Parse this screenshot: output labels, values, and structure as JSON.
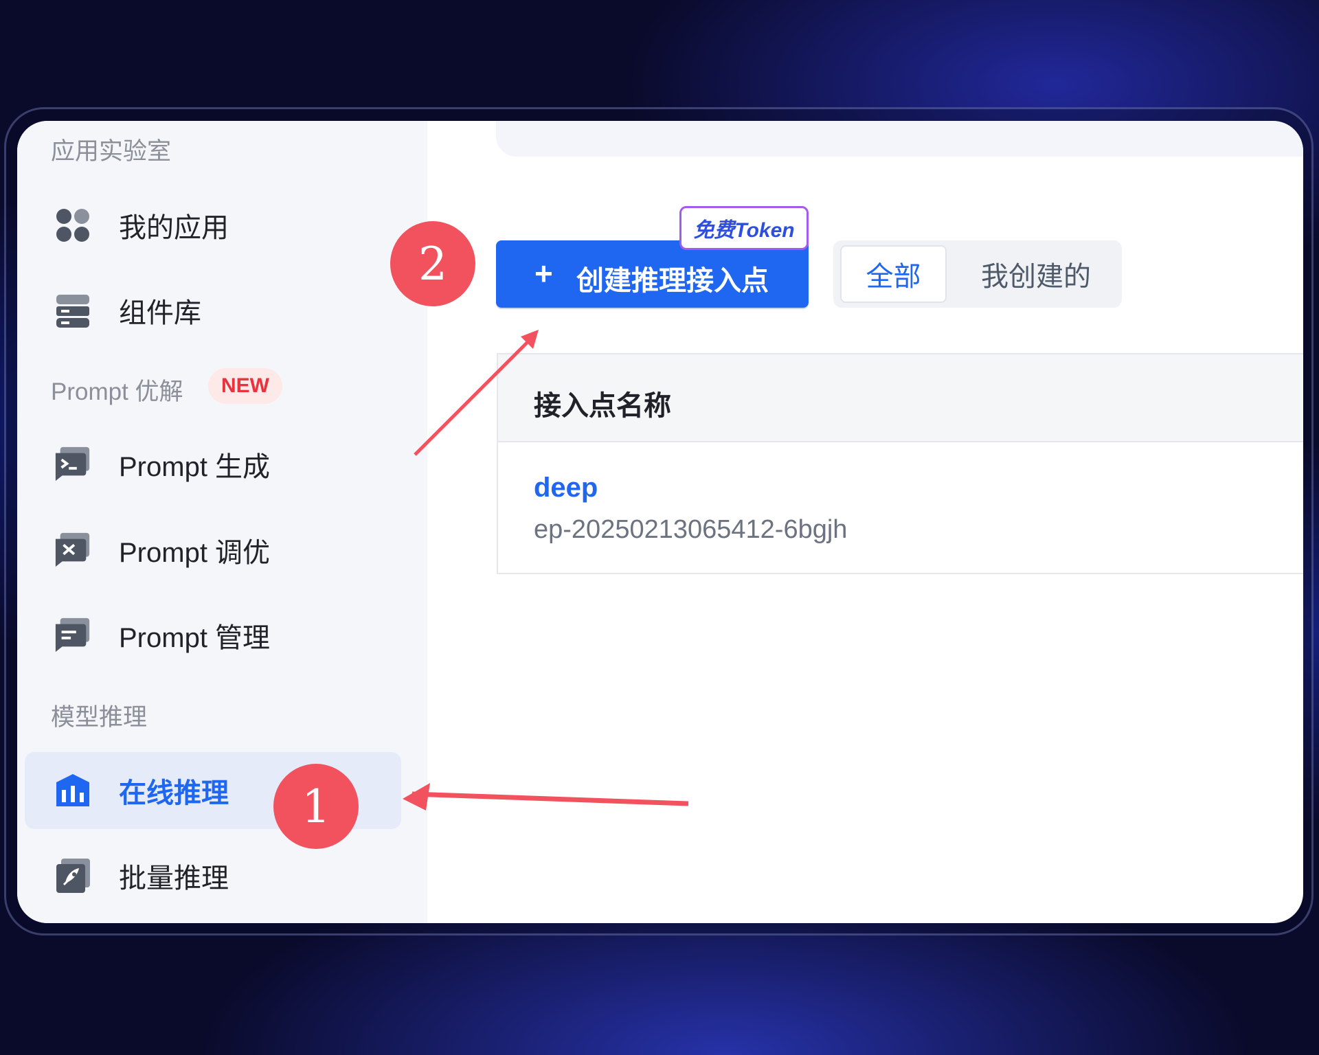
{
  "sidebar": {
    "section_app_lab": "应用实验室",
    "section_prompt": "Prompt 优解",
    "section_prompt_badge": "NEW",
    "section_model_inference": "模型推理",
    "items": [
      {
        "label": "我的应用",
        "icon": "apps-grid-icon"
      },
      {
        "label": "组件库",
        "icon": "component-library-icon"
      },
      {
        "label": "Prompt 生成",
        "icon": "terminal-icon"
      },
      {
        "label": "Prompt 调优",
        "icon": "tune-icon"
      },
      {
        "label": "Prompt 管理",
        "icon": "manage-message-icon"
      },
      {
        "label": "在线推理",
        "icon": "online-inference-icon",
        "active": true
      },
      {
        "label": "批量推理",
        "icon": "rocket-icon"
      }
    ]
  },
  "main": {
    "create_button": {
      "plus": "+",
      "label": "创建推理接入点"
    },
    "free_token_tag": "免费Token",
    "filter_tabs": [
      {
        "label": "全部",
        "active": true
      },
      {
        "label": "我创建的",
        "active": false
      }
    ],
    "table": {
      "header": "接入点名称",
      "rows": [
        {
          "name": "deep",
          "id": "ep-20250213065412-6bgjh"
        }
      ]
    }
  },
  "annotations": {
    "step_1": "1",
    "step_2": "2",
    "marker_color": "#f2525e"
  },
  "colors": {
    "accent": "#1f66f0",
    "sidebar_bg": "#f5f6f9",
    "active_bg": "#e5ebf9",
    "badge_red": "#e8333c"
  }
}
